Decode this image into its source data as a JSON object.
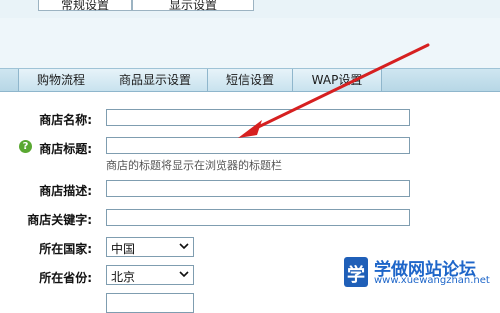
{
  "top_tabs": [
    {
      "label": "常规设置"
    },
    {
      "label": "显示设置"
    }
  ],
  "tabs": [
    {
      "label": "购物流程"
    },
    {
      "label": "商品显示设置"
    },
    {
      "label": "短信设置"
    },
    {
      "label": "WAP设置"
    }
  ],
  "form": {
    "shop_name_label": "商店名称:",
    "shop_title_label": "商店标题:",
    "shop_title_hint": "商店的标题将显示在浏览器的标题栏",
    "shop_desc_label": "商店描述:",
    "shop_keywords_label": "商店关键字:",
    "country_label": "所在国家:",
    "country_value": "中国",
    "province_label": "所在省份:",
    "province_value": "北京"
  },
  "watermark": {
    "logo_char": "学",
    "title": "学做网站论坛",
    "url": "www.xuewangzhan.net"
  },
  "colors": {
    "tabbar": "#b7d7e6",
    "arrow": "#d62020",
    "help_icon": "#5aa832",
    "watermark": "#1e66c9"
  }
}
